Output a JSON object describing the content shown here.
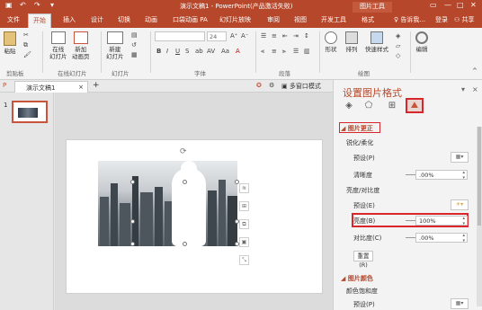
{
  "titlebar": {
    "doc_title": "演示文稿1 - PowerPoint(产品激活失败)",
    "tool_tab": "图片工具"
  },
  "tabs": {
    "items": [
      "文件",
      "开始",
      "插入",
      "设计",
      "切换",
      "动画",
      "口袋动画 PA",
      "幻灯片放映",
      "审阅",
      "视图",
      "开发工具",
      "格式"
    ],
    "active": "开始",
    "tell_me": "告诉我...",
    "login": "登录",
    "share": "共享"
  },
  "ribbon": {
    "groups": {
      "clipboard": "剪贴板",
      "online_slides": "在线幻灯片",
      "slides": "幻灯片",
      "font": "字体",
      "paragraph": "段落",
      "drawing": "绘图"
    },
    "buttons": {
      "paste": "粘贴",
      "online": "在线\n幻灯片",
      "new_animation": "新加\n动画页",
      "new_slide": "新建\n幻灯片",
      "shape": "形状",
      "arrange": "排列",
      "quick_style": "快速样式",
      "edit": "编辑"
    },
    "font_size": "24"
  },
  "doc_tabs": {
    "active": "演示文稿1",
    "multi_window": "多窗口模式"
  },
  "thumbs": {
    "slide_number": "1"
  },
  "pane": {
    "title": "设置图片格式",
    "section_correction": "图片更正",
    "sharpen_label": "锐化/柔化",
    "preset1": "预设(P)",
    "clarity_label": "清晰度",
    "clarity_value": ".00%",
    "brightness_contrast_label": "亮度/对比度",
    "preset2": "预设(E)",
    "brightness_label": "亮度(B)",
    "brightness_value": "100%",
    "contrast_label": "对比度(C)",
    "contrast_value": ".00%",
    "reset": "重置(R)",
    "section_color": "图片颜色",
    "color_saturation": "颜色饱和度",
    "preset3": "预设(P)"
  }
}
